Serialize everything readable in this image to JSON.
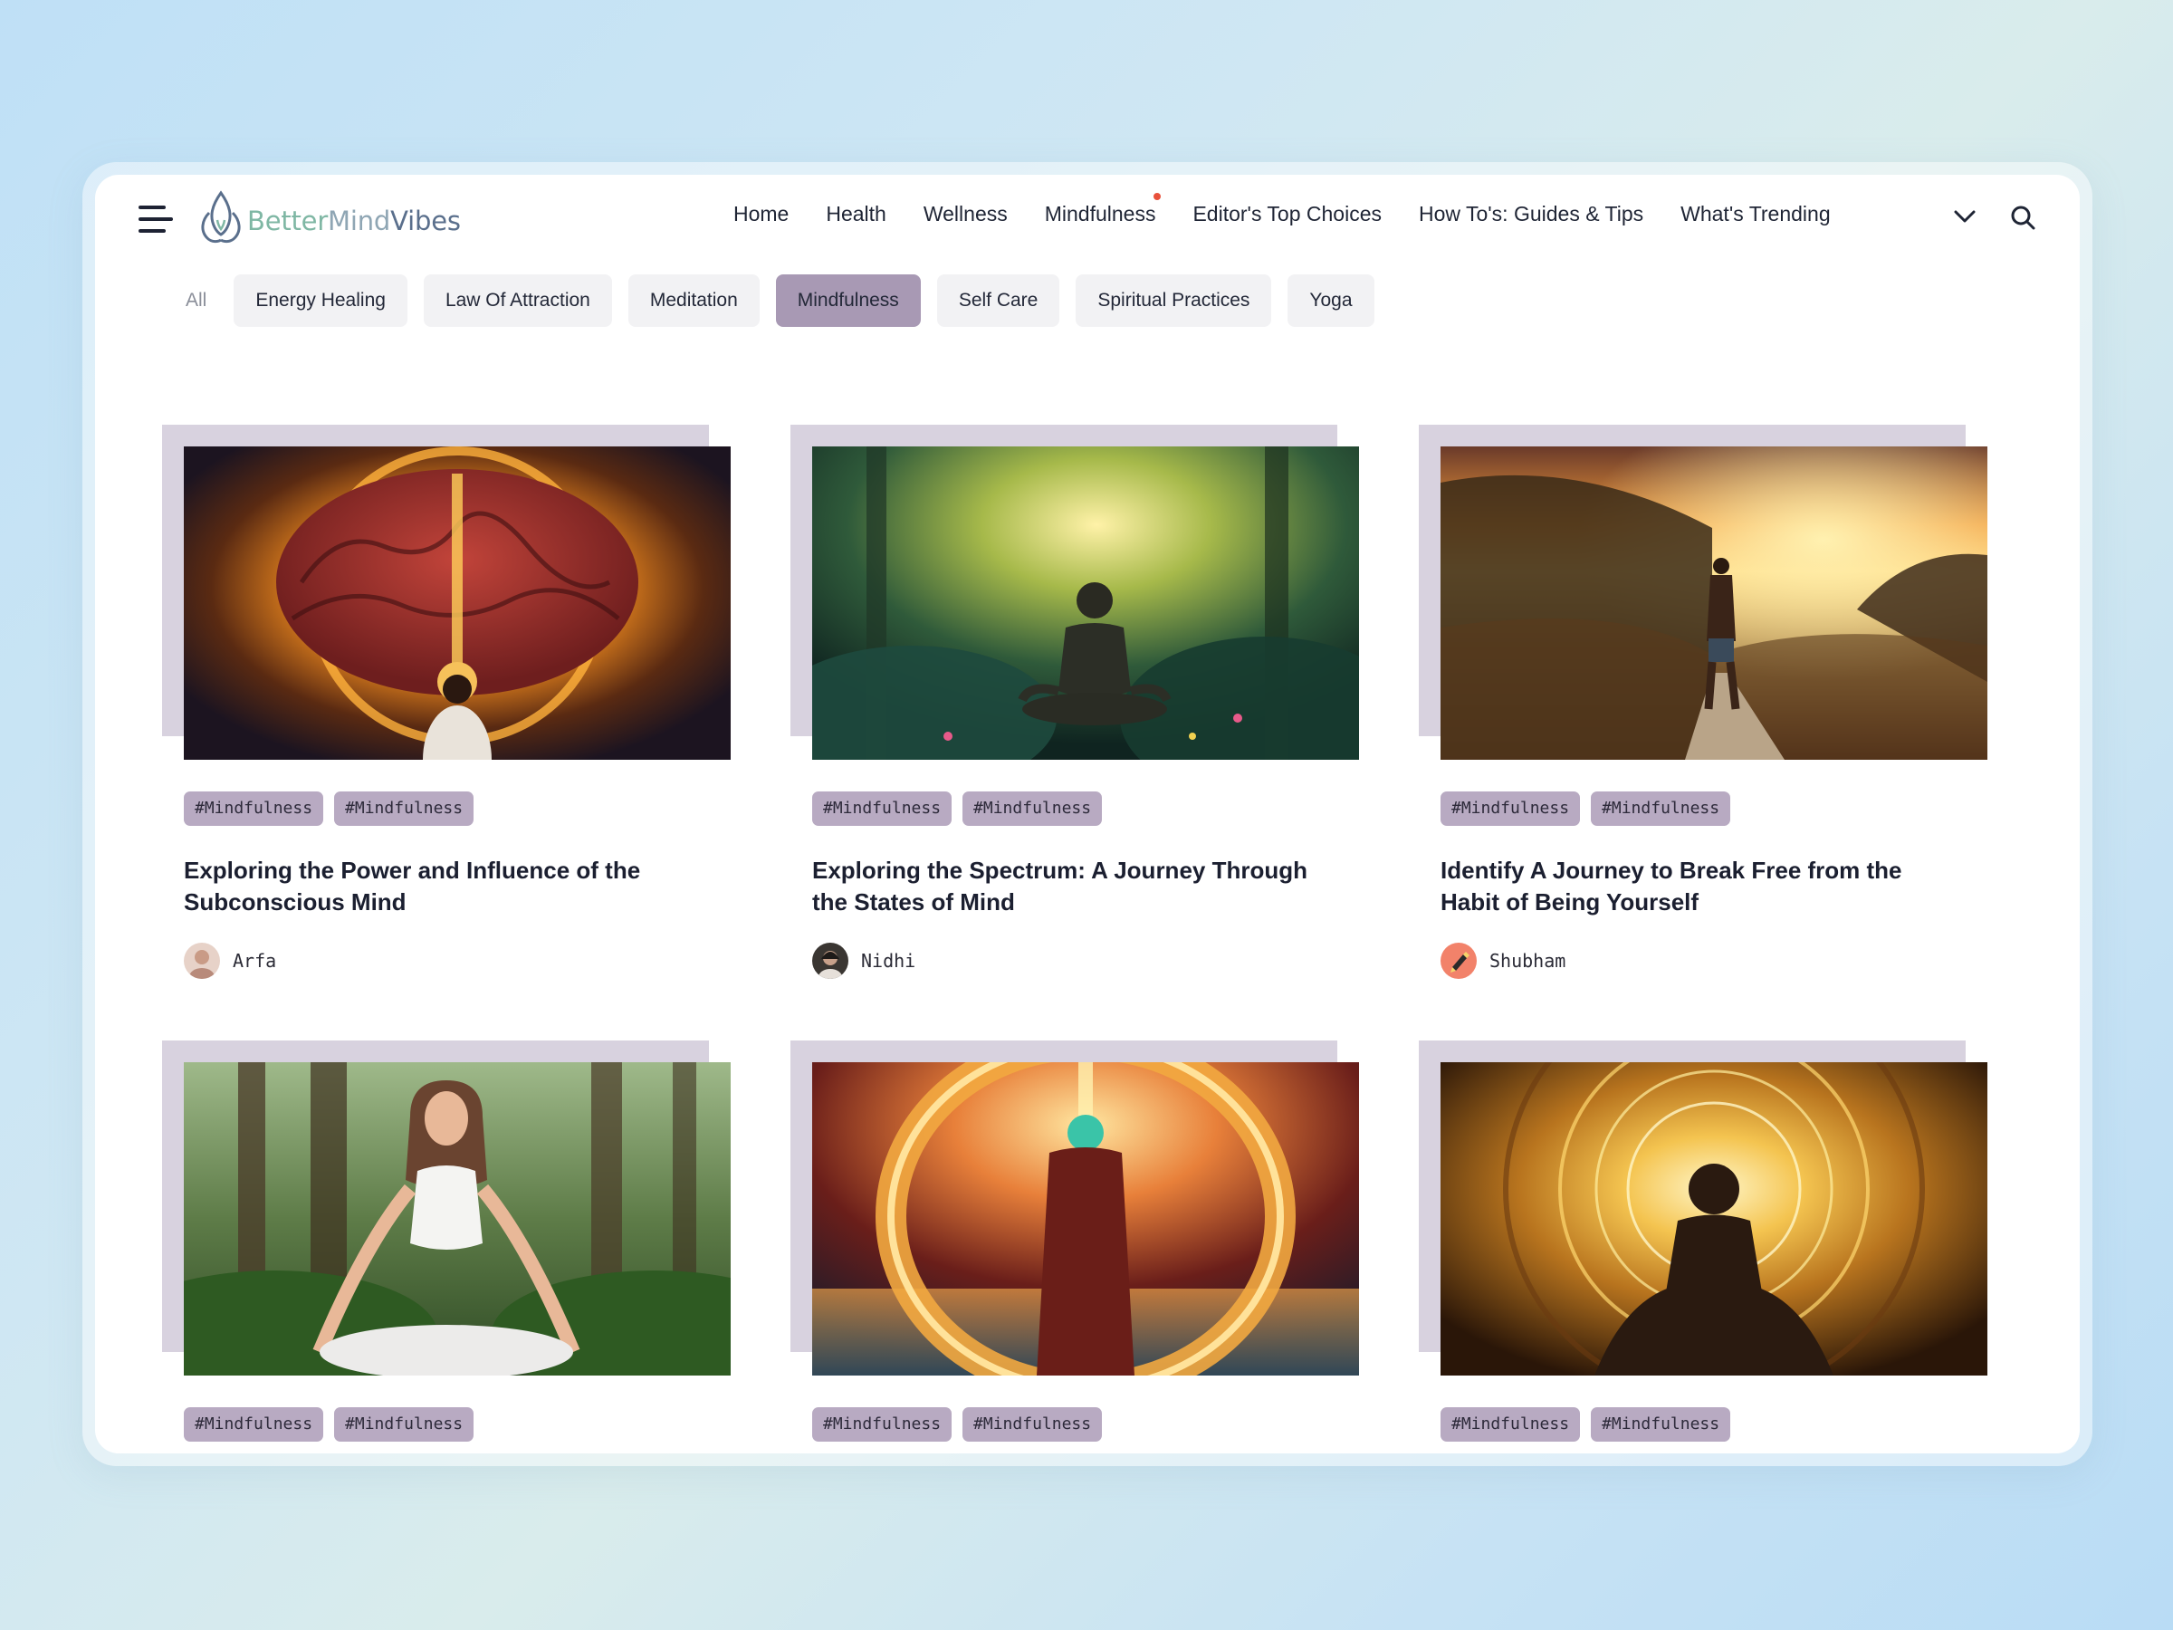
{
  "brand": {
    "part1": "Better",
    "part2": "Mind",
    "part3": "Vibes"
  },
  "nav": [
    {
      "label": "Home"
    },
    {
      "label": "Health"
    },
    {
      "label": "Wellness"
    },
    {
      "label": "Mindfulness",
      "dot": true
    },
    {
      "label": "Editor's Top Choices"
    },
    {
      "label": "How To's: Guides & Tips"
    },
    {
      "label": "What's Trending"
    }
  ],
  "icons": {
    "menu": "hamburger-icon",
    "more": "chevron-down-icon",
    "search": "search-icon"
  },
  "filters": [
    {
      "label": "All",
      "state": "plain"
    },
    {
      "label": "Energy Healing",
      "state": "default"
    },
    {
      "label": "Law Of Attraction",
      "state": "default"
    },
    {
      "label": "Meditation",
      "state": "default"
    },
    {
      "label": "Mindfulness",
      "state": "active"
    },
    {
      "label": "Self Care",
      "state": "default"
    },
    {
      "label": "Spiritual Practices",
      "state": "default"
    },
    {
      "label": "Yoga",
      "state": "default"
    }
  ],
  "colors": {
    "accent": "#a899b4",
    "tag": "#b8aac2",
    "card_backdrop": "#d8d2df",
    "notification_dot": "#e8513b"
  },
  "cards": [
    {
      "image": "glowing brain with meditating figure",
      "tags": [
        "#Mindfulness",
        "#Mindfulness"
      ],
      "title": "Exploring the Power and Influence of the Subconscious Mind",
      "author": "Arfa"
    },
    {
      "image": "figure meditating in enchanted forest",
      "tags": [
        "#Mindfulness",
        "#Mindfulness"
      ],
      "title": "Exploring the Spectrum: A Journey Through the States of Mind",
      "author": "Nidhi"
    },
    {
      "image": "man walking on road at sunset",
      "tags": [
        "#Mindfulness",
        "#Mindfulness"
      ],
      "title": "Identify A Journey to Break Free from the Habit of Being Yourself",
      "author": "Shubham"
    },
    {
      "image": "woman meditating in forest",
      "tags": [
        "#Mindfulness",
        "#Mindfulness"
      ]
    },
    {
      "image": "man facing glowing ring portal",
      "tags": [
        "#Mindfulness",
        "#Mindfulness"
      ]
    },
    {
      "image": "silhouette meditating before golden mandala",
      "tags": [
        "#Mindfulness",
        "#Mindfulness"
      ]
    }
  ]
}
